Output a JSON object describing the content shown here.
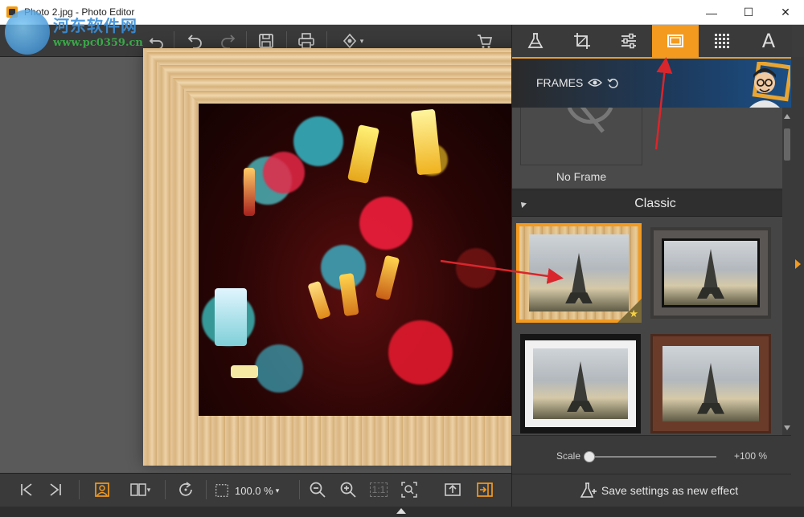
{
  "window": {
    "title": "Photo 2.jpg - Photo Editor",
    "controls": {
      "minimize": "—",
      "maximize": "☐",
      "close": "✕"
    }
  },
  "watermark": {
    "line1": "河东软件网",
    "line2": "www.pc0359.cn"
  },
  "toolbar": {
    "icons": [
      "undo-history-icon",
      "undo-icon",
      "redo-icon",
      "save-icon",
      "print-icon",
      "share-icon",
      "cart-icon"
    ]
  },
  "right_tabs": {
    "items": [
      "effects",
      "crop",
      "adjust",
      "frames",
      "texture",
      "text"
    ],
    "active": "frames",
    "text_tab_label": "A"
  },
  "frames_panel": {
    "title": "FRAMES",
    "no_frame_label": "No Frame",
    "section": "Classic",
    "thumbnails": [
      {
        "style": "light-wood",
        "selected": true,
        "premium": true
      },
      {
        "style": "dark-grey",
        "selected": false,
        "premium": false
      },
      {
        "style": "white-black",
        "selected": false,
        "premium": false
      },
      {
        "style": "brown-wood",
        "selected": false,
        "premium": false
      }
    ],
    "scale": {
      "label": "Scale",
      "value_text": "+100 %",
      "position": 0.0
    },
    "save_label": "Save settings as new effect"
  },
  "bottombar": {
    "zoom": "100.0 %",
    "fit_label": "1:1"
  },
  "colors": {
    "accent": "#f39a1f",
    "annotation_arrow": "#d9262c"
  }
}
